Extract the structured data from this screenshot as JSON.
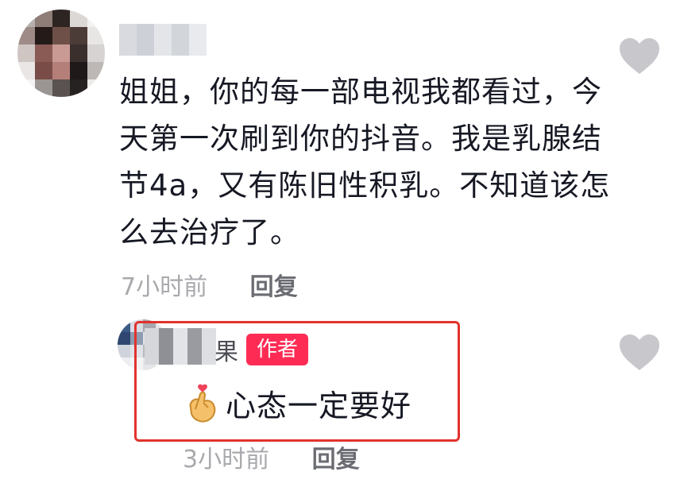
{
  "comment": {
    "text": "姐姐，你的每一部电视我都看过，今天第一次刷到你的抖音。我是乳腺结节4a，又有陈旧性积乳。不知道该怎么去治疗了。",
    "time": "7小时前",
    "reply_label": "回复",
    "like_icon": "heart-icon"
  },
  "reply": {
    "author_name_visible": "果",
    "author_badge": "作者",
    "emoji_icon": "finger-heart-icon",
    "text": "心态一定要好",
    "time": "3小时前",
    "reply_label": "回复",
    "like_icon": "heart-icon",
    "highlight_color": "#e2322d"
  },
  "colors": {
    "text": "#161823",
    "meta": "#a8a9ad",
    "badge": "#fe2c55",
    "heart": "#c8c8cc"
  }
}
